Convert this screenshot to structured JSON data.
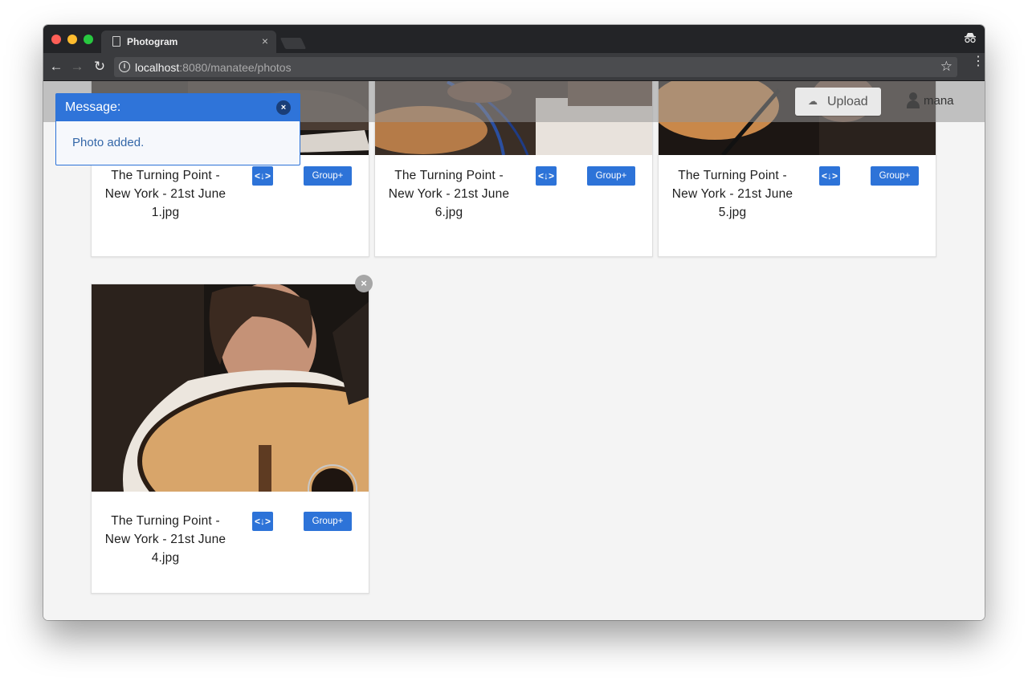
{
  "browser": {
    "tab_title": "Photogram",
    "tab_close": "×",
    "url_host": "localhost",
    "url_rest": ":8080/manatee/photos",
    "nav_back": "←",
    "nav_forward": "→",
    "nav_reload": "↻",
    "star": "☆",
    "menu": "⋮"
  },
  "header": {
    "upload_label": "Upload",
    "user_name": "mana"
  },
  "message": {
    "title": "Message:",
    "close": "×",
    "body": "Photo added."
  },
  "photos": [
    {
      "caption": "The Turning Point - New York - 21st June 1.jpg",
      "embed_label": "<↓>",
      "group_label": "Group+"
    },
    {
      "caption": "The Turning Point - New York - 21st June 6.jpg",
      "embed_label": "<↓>",
      "group_label": "Group+"
    },
    {
      "caption": "The Turning Point - New York - 21st June 5.jpg",
      "embed_label": "<↓>",
      "group_label": "Group+"
    },
    {
      "caption": "The Turning Point - New York - 21st June 4.jpg",
      "embed_label": "<↓>",
      "group_label": "Group+",
      "remove": "×"
    }
  ],
  "colors": {
    "accent": "#2d73d8",
    "message_header": "#2f74d9",
    "page_bg": "#f4f4f4"
  }
}
